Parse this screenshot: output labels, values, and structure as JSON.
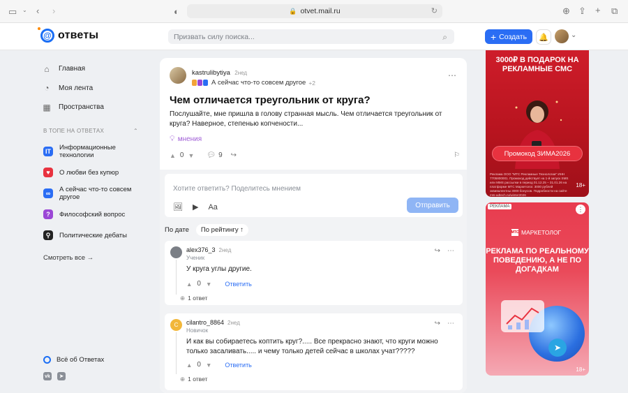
{
  "browser": {
    "url": "otvet.mail.ru"
  },
  "header": {
    "logo_text": "ответы",
    "search_placeholder": "Призвать силу поиска...",
    "create_label": "Создать"
  },
  "sidebar": {
    "nav": [
      {
        "label": "Главная",
        "icon": "home-icon"
      },
      {
        "label": "Моя лента",
        "icon": "feed-icon"
      },
      {
        "label": "Пространства",
        "icon": "spaces-icon"
      }
    ],
    "section_title": "В ТОПЕ НА ОТВЕТАХ",
    "topics": [
      {
        "label": "Информационные технологии",
        "color": "#2a6df4",
        "glyph": "IT"
      },
      {
        "label": "О любви без купюр",
        "color": "#e8323f",
        "glyph": "♥"
      },
      {
        "label": "А сейчас что-то совсем другое",
        "color": "#2a6df4",
        "glyph": "∞"
      },
      {
        "label": "Философский вопрос",
        "color": "#9b47d6",
        "glyph": "?"
      },
      {
        "label": "Политические дебаты",
        "color": "#222222",
        "glyph": "⚲"
      }
    ],
    "see_all": "Смотреть все →",
    "about": "Всё об Ответах",
    "socials": [
      "vk",
      "tg"
    ]
  },
  "question": {
    "author": "kastrulibytiya",
    "time": "2нед",
    "category": "А сейчас что-то совсем другое",
    "extra_tags": "+2",
    "title": "Чем отличается треугольник от круга?",
    "body": "Послушайте, мне пришла в голову странная мысль. Чем отличается треугольник от круга? Наверное, степенью копчености...",
    "opinions_label": "мнения",
    "votes": "0",
    "comments": "9"
  },
  "reply": {
    "placeholder": "Хотите ответить? Поделитесь мнением",
    "font_label": "Aa",
    "send_label": "Отправить"
  },
  "sort": {
    "by_date": "По дате",
    "by_rating": "По рейтингу ↑"
  },
  "answers": [
    {
      "author": "alex376_3",
      "time": "2нед",
      "rank": "Ученик",
      "text": "У круга углы другие.",
      "votes": "0",
      "reply_label": "Ответить",
      "replies": "1 ответ",
      "avatar_color": "#7b7f86",
      "avatar_letter": ""
    },
    {
      "author": "cilantro_8864",
      "time": "2нед",
      "rank": "Новичок",
      "text": "И как вы собираетесь коптить круг?..... Все прекрасно знают, что круги можно только засаливать..... и чему только детей сейчас в школах учат?????",
      "votes": "0",
      "reply_label": "Ответить",
      "replies": "1 ответ",
      "avatar_color": "#f2b73a",
      "avatar_letter": "C"
    }
  ],
  "ads": {
    "ad1": {
      "headline": "3000₽ В ПОДАРОК НА РЕКЛАМНЫЕ СМС",
      "promo": "Промокод ЗИМА2026",
      "fine_print": "Реклама ООО \"МТС Рекламные Технологии\" ИНН 7705800001. Промокод действует на 1-й запуск SMS или MMS рассылки в период 01.12.25 – 31.01.26 на платформе МТС Маркетолог. 3000 рублей эквивалентны 3000 бонусов. Подробности на сайте mts-adtech.ru/winter2026",
      "age": "18+"
    },
    "ad2": {
      "tag": "РЕКЛАМА",
      "brand": "МАРКЕТОЛОГ",
      "brand_mark": "МТС",
      "headline": "РЕКЛАМА ПО РЕАЛЬНОМУ ПОВЕДЕНИЮ, А НЕ ПО ДОГАДКАМ",
      "age": "18+"
    }
  }
}
